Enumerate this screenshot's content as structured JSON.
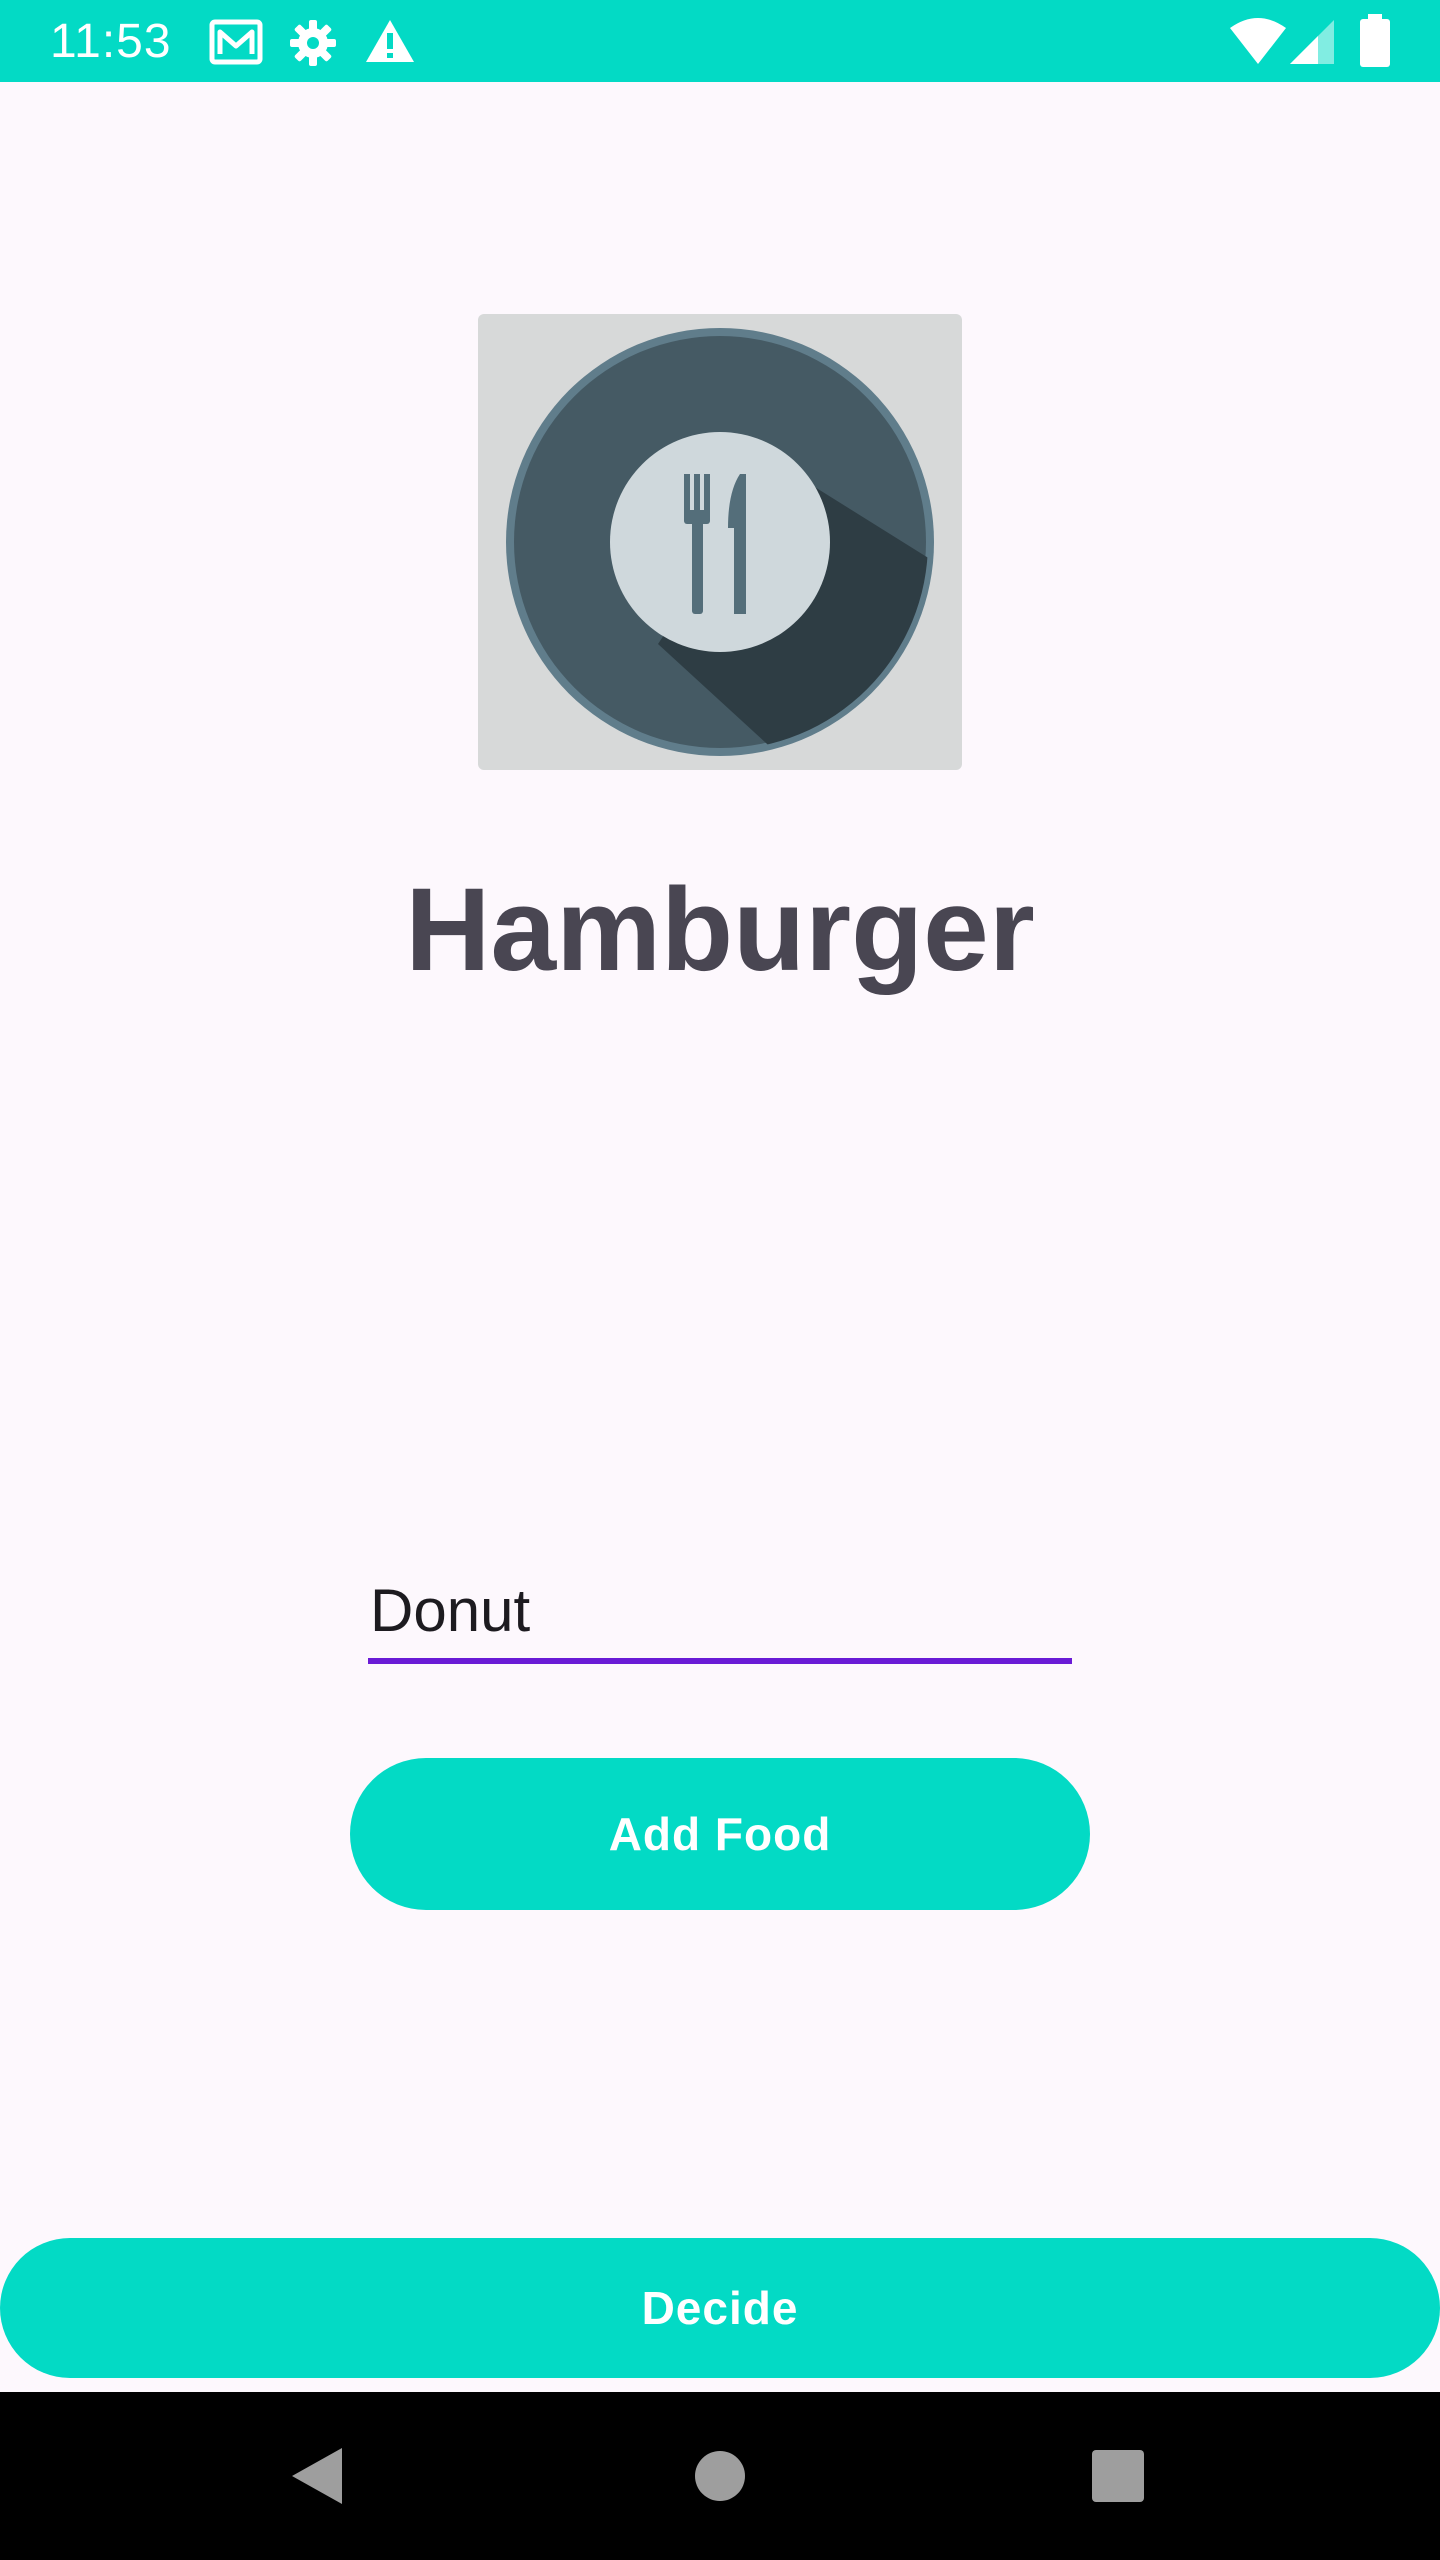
{
  "status_bar": {
    "time": "11:53",
    "left_icons": [
      "gmail-icon",
      "settings-gear-icon",
      "warning-icon"
    ],
    "right_icons": [
      "wifi-icon",
      "cell-signal-icon",
      "battery-icon"
    ],
    "background_color": "#03dac5"
  },
  "main": {
    "image_icon": "plate-fork-knife-icon",
    "food_name": "Hamburger",
    "food_input": {
      "value": "Donut",
      "placeholder": ""
    },
    "add_food_label": "Add Food",
    "decide_label": "Decide"
  },
  "colors": {
    "accent": "#03dac5",
    "input_underline": "#6a1bd6",
    "title_text": "#494652",
    "background": "#fdf8fd"
  },
  "nav_bar": {
    "buttons": [
      "back-icon",
      "home-icon",
      "recents-icon"
    ]
  }
}
